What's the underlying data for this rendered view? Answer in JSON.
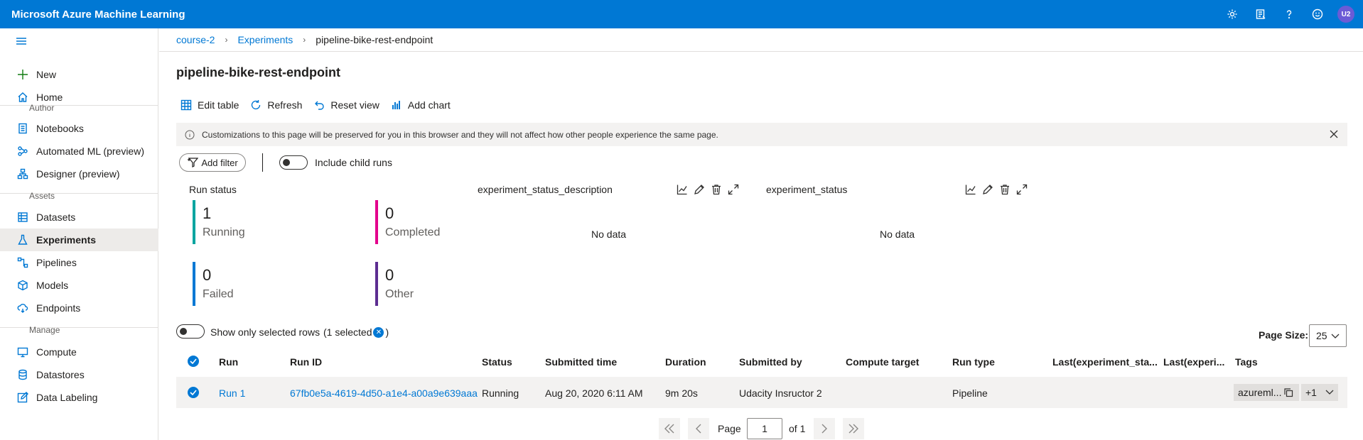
{
  "app": {
    "title": "Microsoft Azure Machine Learning",
    "avatar_initials": "U2",
    "accent_color": "#0078d4"
  },
  "topbar_icons": [
    "gear-icon",
    "notebook-list-icon",
    "help-icon",
    "smiley-icon"
  ],
  "sidebar": {
    "new_label": "New",
    "home_label": "Home",
    "author_header": "Author",
    "author_items": [
      "Notebooks",
      "Automated ML (preview)",
      "Designer (preview)"
    ],
    "assets_header": "Assets",
    "assets_items": [
      "Datasets",
      "Experiments",
      "Pipelines",
      "Models",
      "Endpoints"
    ],
    "manage_header": "Manage",
    "manage_items": [
      "Compute",
      "Datastores",
      "Data Labeling"
    ],
    "active": "Experiments"
  },
  "breadcrumb": [
    "course-2",
    "Experiments",
    "pipeline-bike-rest-endpoint"
  ],
  "page_title": "pipeline-bike-rest-endpoint",
  "toolbar": {
    "edit_table": "Edit table",
    "refresh": "Refresh",
    "reset_view": "Reset view",
    "add_chart": "Add chart"
  },
  "info_message": "Customizations to this page will be preserved for you in this browser and they will not affect how other people experience the same page.",
  "filters": {
    "add_filter": "Add filter",
    "include_child_runs": "Include child runs",
    "include_child_runs_on": false
  },
  "run_status": {
    "title": "Run status",
    "cards": [
      {
        "count": "1",
        "label": "Running",
        "color": "#00a5a0"
      },
      {
        "count": "0",
        "label": "Completed",
        "color": "#e3008c"
      },
      {
        "count": "0",
        "label": "Failed",
        "color": "#0078d4"
      },
      {
        "count": "0",
        "label": "Other",
        "color": "#5c2d91"
      }
    ]
  },
  "charts": [
    {
      "title": "experiment_status_description",
      "message": "No data"
    },
    {
      "title": "experiment_status",
      "message": "No data"
    }
  ],
  "selection": {
    "show_only_selected": "Show only selected rows",
    "selected_prefix": "(1 selected",
    "selected_suffix": ")",
    "show_only_selected_on": false
  },
  "page_size": {
    "label": "Page Size:",
    "value": "25"
  },
  "table": {
    "columns": [
      "Run",
      "Run ID",
      "Status",
      "Submitted time",
      "Duration",
      "Submitted by",
      "Compute target",
      "Run type",
      "Last(experiment_sta...",
      "Last(experi...",
      "Tags"
    ],
    "rows": [
      {
        "run": "Run 1",
        "run_id": "67fb0e5a-4619-4d50-a1e4-a00a9e639aaa",
        "status": "Running",
        "submitted_time": "Aug 20, 2020 6:11 AM",
        "duration": "9m 20s",
        "submitted_by": "Udacity Insructor 2",
        "compute_target": "",
        "run_type": "Pipeline",
        "last_status": "",
        "last_experi": "",
        "tag": "azureml...",
        "tag_more": "+1",
        "selected": true
      }
    ]
  },
  "pagination": {
    "page_label": "Page",
    "current": "1",
    "of_label": "of 1"
  }
}
